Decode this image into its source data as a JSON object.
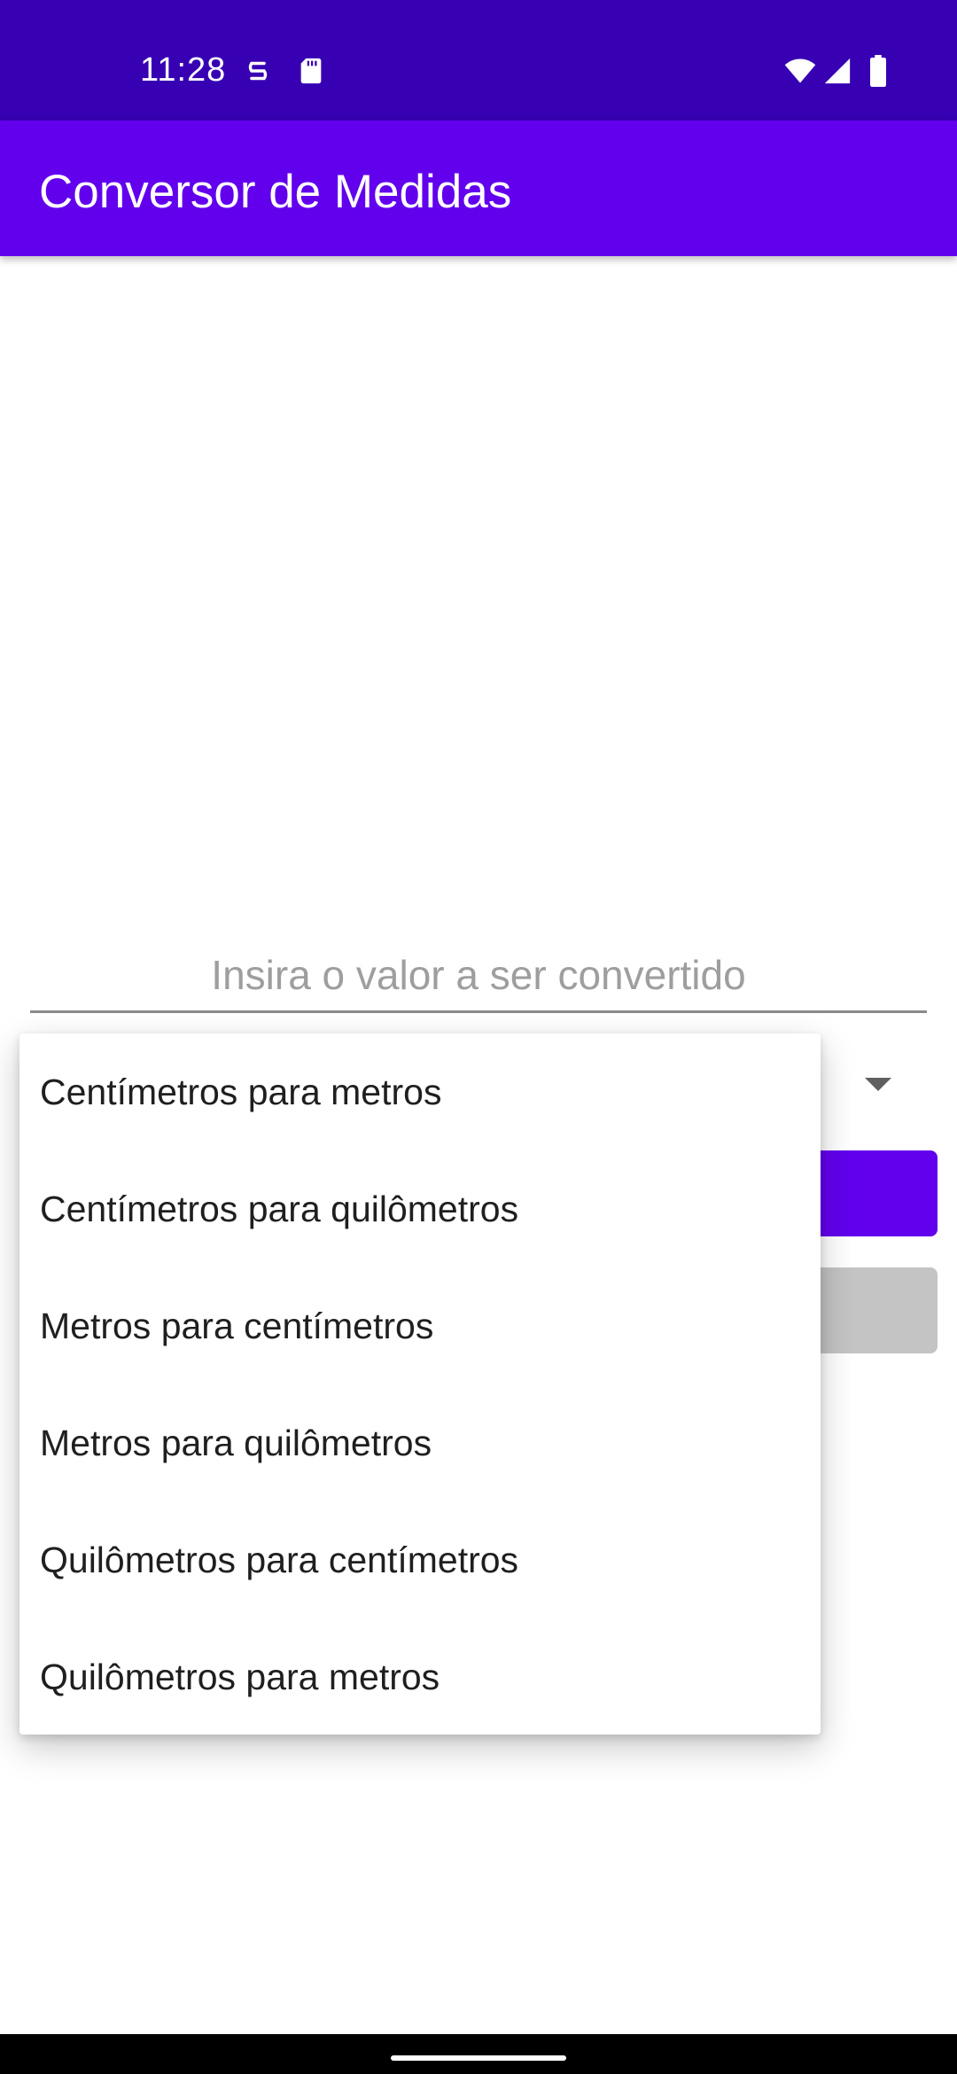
{
  "status_bar": {
    "time": "11:28",
    "icons": [
      "sync-icon",
      "sd-card-icon",
      "wifi-icon",
      "signal-icon",
      "battery-icon"
    ],
    "background": "#3700B3"
  },
  "app_bar": {
    "title": "Conversor de Medidas",
    "background": "#6200EE"
  },
  "input": {
    "placeholder": "Insira o valor a ser convertido",
    "value": ""
  },
  "dropdown": {
    "options": [
      "Centímetros para metros",
      "Centímetros para quilômetros",
      "Metros para centímetros",
      "Metros para quilômetros",
      "Quilômetros para centímetros",
      "Quilômetros para metros"
    ]
  },
  "colors": {
    "primary": "#6200EE",
    "primary_dark": "#3700B3",
    "secondary_button": "#C4C4C4"
  }
}
